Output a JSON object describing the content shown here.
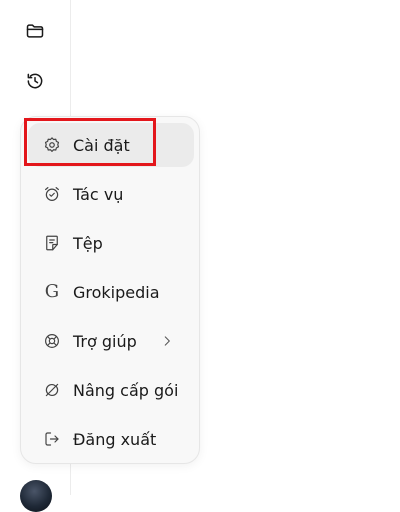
{
  "menu": {
    "items": [
      {
        "label": "Cài đặt",
        "icon": "gear-icon"
      },
      {
        "label": "Tác vụ",
        "icon": "alarm-clock-icon"
      },
      {
        "label": "Tệp",
        "icon": "file-note-icon"
      },
      {
        "label": "Grokipedia",
        "icon": "g-letter-icon",
        "glyph": "G"
      },
      {
        "label": "Trợ giúp",
        "icon": "lifebuoy-icon"
      },
      {
        "label": "Nâng cấp gói",
        "icon": "slashed-circle-icon"
      },
      {
        "label": "Đăng xuất",
        "icon": "logout-icon"
      }
    ]
  },
  "sidebar": {
    "icons": [
      "folder-icon",
      "history-icon"
    ]
  },
  "colors": {
    "highlight": "#e3161b",
    "menu_bg": "#f8f8f8",
    "active_bg": "#ebebeb"
  }
}
